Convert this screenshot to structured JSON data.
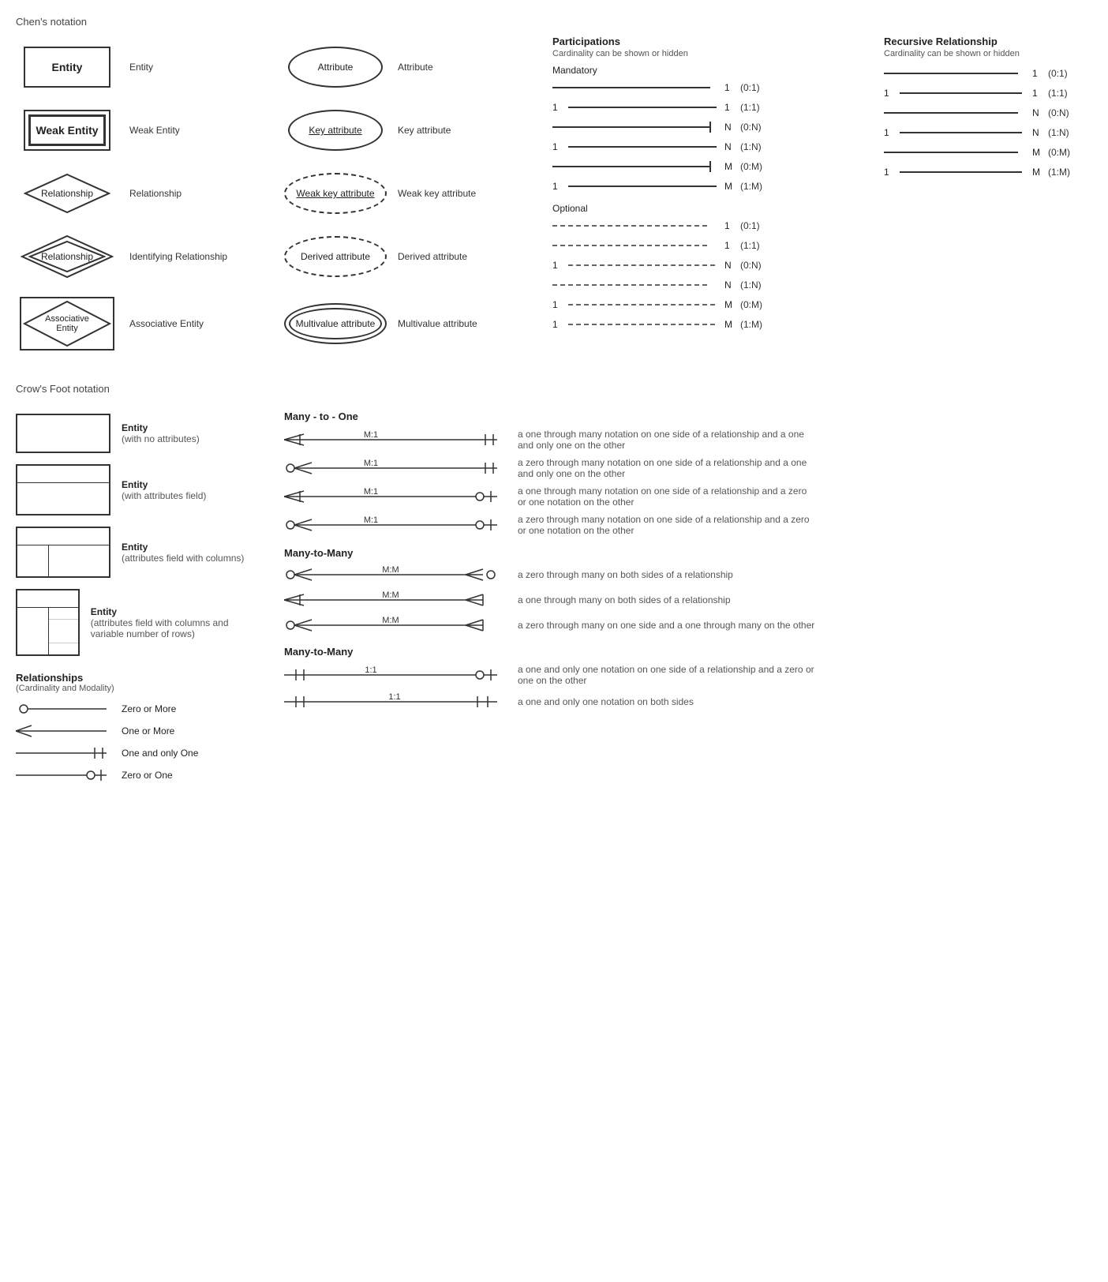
{
  "chens": {
    "title": "Chen's notation",
    "left_items": [
      {
        "shape": "entity",
        "shape_label": "Entity",
        "label": "Entity"
      },
      {
        "shape": "weak-entity",
        "shape_label": "Weak Entity",
        "label": "Weak Entity"
      },
      {
        "shape": "diamond",
        "shape_label": "Relationship",
        "label": "Relationship"
      },
      {
        "shape": "diamond-double",
        "shape_label": "Relationship",
        "label": "Identifying Relationship"
      },
      {
        "shape": "associative",
        "shape_label": "Associative Entity",
        "label": "Associative Entity"
      }
    ],
    "right_items": [
      {
        "shape": "ellipse",
        "shape_label": "Attribute",
        "label": "Attribute"
      },
      {
        "shape": "ellipse-key",
        "shape_label": "Key attribute",
        "label": "Key attribute"
      },
      {
        "shape": "ellipse-weakkey",
        "shape_label": "Weak key attribute",
        "label": "Weak key attribute"
      },
      {
        "shape": "ellipse-derived",
        "shape_label": "Derived attribute",
        "label": "Derived attribute"
      },
      {
        "shape": "ellipse-multi",
        "shape_label": "Multivalue attribute",
        "label": "Multivalue attribute"
      }
    ]
  },
  "participations": {
    "title": "Participations",
    "subtitle": "Cardinality can be shown or hidden",
    "mandatory": {
      "label": "Mandatory",
      "rows": [
        {
          "left": "",
          "right": "1",
          "cardinality": "(0:1)",
          "dashed": false
        },
        {
          "left": "1",
          "right": "1",
          "cardinality": "(1:1)",
          "dashed": false
        },
        {
          "left": "",
          "right": "N",
          "cardinality": "(0:N)",
          "dashed": false
        },
        {
          "left": "1",
          "right": "N",
          "cardinality": "(1:N)",
          "dashed": false
        },
        {
          "left": "",
          "right": "M",
          "cardinality": "(0:M)",
          "dashed": false
        },
        {
          "left": "1",
          "right": "M",
          "cardinality": "(1:M)",
          "dashed": false
        }
      ]
    },
    "optional": {
      "label": "Optional",
      "rows": [
        {
          "left": "",
          "right": "1",
          "cardinality": "(0:1)",
          "dashed": true
        },
        {
          "left": "",
          "right": "1",
          "cardinality": "(1:1)",
          "dashed": true
        },
        {
          "left": "1",
          "right": "N",
          "cardinality": "(0:N)",
          "dashed": true
        },
        {
          "left": "",
          "right": "N",
          "cardinality": "(1:N)",
          "dashed": true
        },
        {
          "left": "1",
          "right": "M",
          "cardinality": "(0:M)",
          "dashed": true
        },
        {
          "left": "1",
          "right": "M",
          "cardinality": "(1:M)",
          "dashed": true
        }
      ]
    }
  },
  "recursive": {
    "title": "Recursive Relationship",
    "subtitle": "Cardinality can be shown or hidden",
    "rows": [
      {
        "left": "",
        "right": "1",
        "cardinality": "(0:1)"
      },
      {
        "left": "1",
        "right": "1",
        "cardinality": "(1:1)"
      },
      {
        "left": "",
        "right": "N",
        "cardinality": "(0:N)"
      },
      {
        "left": "1",
        "right": "N",
        "cardinality": "(1:N)"
      },
      {
        "left": "",
        "right": "M",
        "cardinality": "(0:M)"
      },
      {
        "left": "1",
        "right": "M",
        "cardinality": "(1:M)"
      }
    ]
  },
  "crows": {
    "title": "Crow's Foot notation",
    "entities": [
      {
        "type": "simple",
        "label": "Entity",
        "sublabel": "(with no attributes)"
      },
      {
        "type": "attrs",
        "label": "Entity",
        "sublabel": "(with attributes field)"
      },
      {
        "type": "cols",
        "label": "Entity",
        "sublabel": "(attributes field with columns)"
      },
      {
        "type": "var",
        "label": "Entity",
        "sublabel": "(attributes field with columns and variable number of rows)"
      }
    ],
    "legend": {
      "title": "Relationships",
      "subtitle": "(Cardinality and Modality)",
      "items": [
        {
          "type": "zero-more",
          "label": "Zero or More"
        },
        {
          "type": "one-more",
          "label": "One or More"
        },
        {
          "type": "one-only",
          "label": "One and only One"
        },
        {
          "type": "zero-one",
          "label": "Zero or One"
        }
      ]
    },
    "many_to_one": {
      "label": "Many - to - One",
      "rows": [
        {
          "left": "many-one",
          "label_center": "M:1",
          "right": "one-only",
          "description": "a one through many notation on one side of a relationship and a one and only one on the other"
        },
        {
          "left": "zero-many",
          "label_center": "M:1",
          "right": "one-only",
          "description": "a zero through many notation on one side of a relationship and a one and only one on the other"
        },
        {
          "left": "many-one",
          "label_center": "M:1",
          "right": "zero-one",
          "description": "a one through many notation on one side of a relationship and a zero or one notation on the other"
        },
        {
          "left": "zero-many",
          "label_center": "M:1",
          "right": "zero-one",
          "description": "a zero through many notation on one side of a relationship and a zero or one notation on the other"
        }
      ]
    },
    "many_to_many": {
      "label": "Many-to-Many",
      "rows": [
        {
          "left": "zero-many",
          "label_center": "M:M",
          "right": "zero-many-r",
          "description": "a zero through many on both sides of a relationship"
        },
        {
          "left": "many-one",
          "label_center": "M:M",
          "right": "many-one-r",
          "description": "a one through many on both sides of a relationship"
        },
        {
          "left": "zero-many",
          "label_center": "M:M",
          "right": "many-one-r",
          "description": "a zero through many on one side and a one through many on the other"
        }
      ]
    },
    "one_to_one": {
      "label": "Many-to-Many",
      "rows": [
        {
          "left": "one-only",
          "label_center": "1:1",
          "right": "zero-one",
          "description": "a one and only one notation on one side of a relationship and a zero or one on the other"
        },
        {
          "left": "one-only",
          "label_center": "1:1",
          "right": "one-only-r",
          "description": "a one and only one notation on both sides"
        }
      ]
    }
  }
}
